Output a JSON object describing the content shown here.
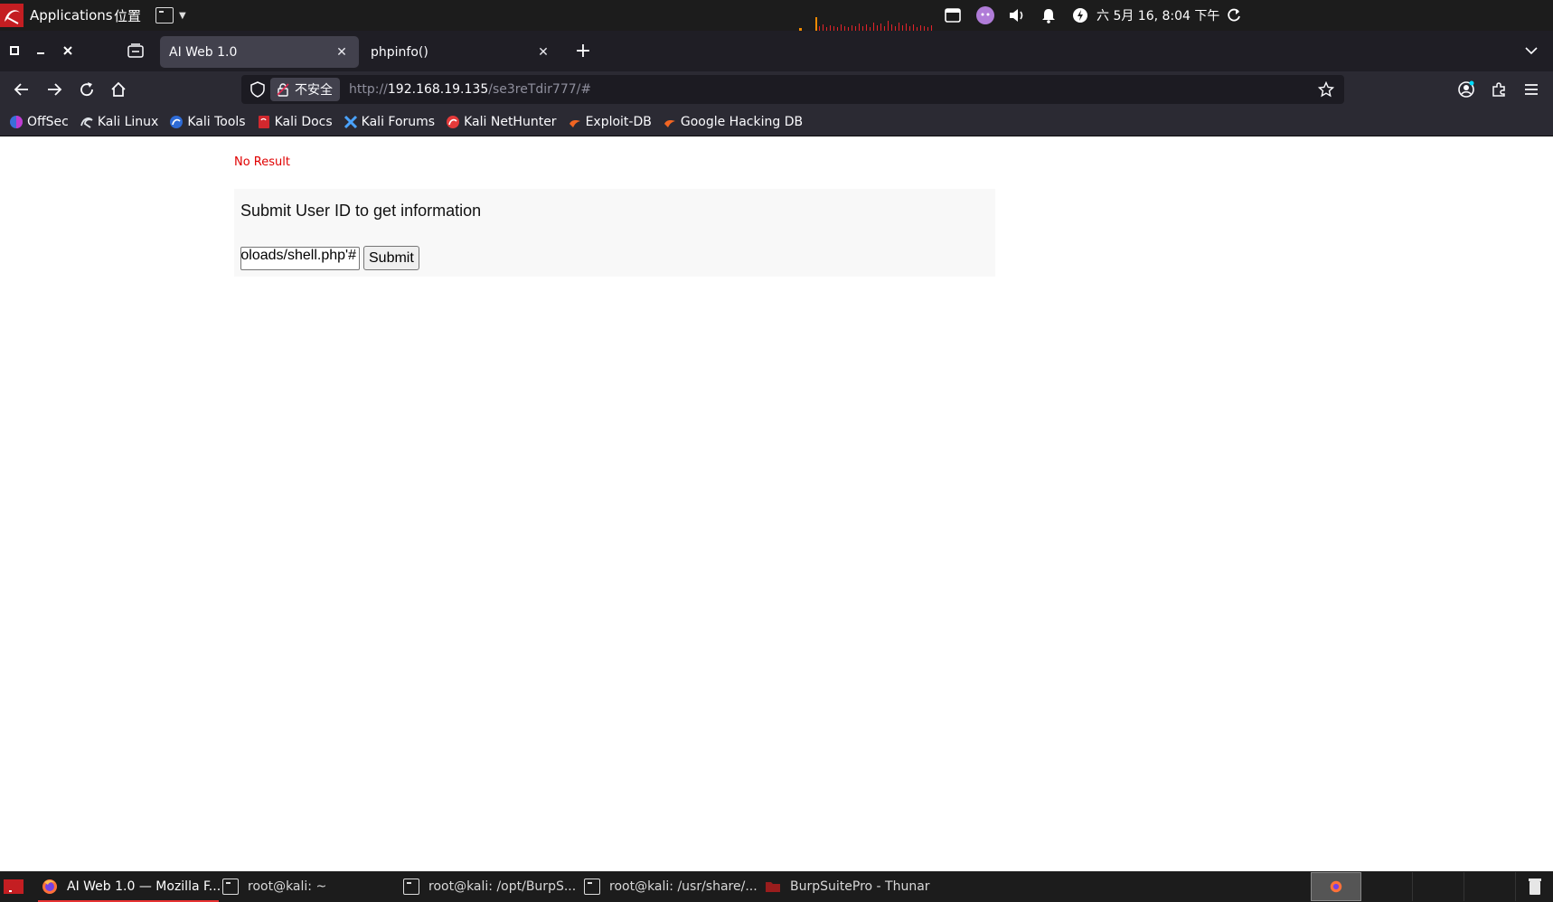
{
  "top_panel": {
    "applications_label": "Applications",
    "places_label": "位置",
    "clock": "六 5月 16,  8:04 下午"
  },
  "browser": {
    "tabs": [
      {
        "title": "AI Web 1.0",
        "active": true
      },
      {
        "title": "phpinfo()",
        "active": false
      }
    ],
    "address": {
      "security_label": "不安全",
      "scheme": "http://",
      "host": "192.168.19.135",
      "path": "/se3reTdir777/#"
    },
    "bookmarks": [
      {
        "label": "OffSec",
        "icon": "offsec-icon"
      },
      {
        "label": "Kali Linux",
        "icon": "kali-linux-icon"
      },
      {
        "label": "Kali Tools",
        "icon": "kali-tools-icon"
      },
      {
        "label": "Kali Docs",
        "icon": "kali-docs-icon"
      },
      {
        "label": "Kali Forums",
        "icon": "kali-forums-icon"
      },
      {
        "label": "Kali NetHunter",
        "icon": "kali-nethunter-icon"
      },
      {
        "label": "Exploit-DB",
        "icon": "exploit-db-icon"
      },
      {
        "label": "Google Hacking DB",
        "icon": "ghdb-icon"
      }
    ]
  },
  "page": {
    "status": "No Result",
    "heading": "Submit User ID to get information",
    "input_value": "oloads/shell.php'#",
    "submit_label": "Submit"
  },
  "taskbar": {
    "tasks": [
      {
        "label": "AI Web 1.0 — Mozilla F...",
        "icon": "firefox-icon",
        "active": true
      },
      {
        "label": "root@kali: ~",
        "icon": "terminal-icon",
        "active": false
      },
      {
        "label": "root@kali: /opt/BurpS...",
        "icon": "terminal-icon",
        "active": false
      },
      {
        "label": "root@kali: /usr/share/...",
        "icon": "terminal-icon",
        "active": false
      },
      {
        "label": "BurpSuitePro - Thunar",
        "icon": "folder-icon",
        "active": false
      }
    ]
  },
  "colors": {
    "no_result": "#e00000",
    "panel_bg": "#f8f8f8",
    "tab_active": "#42414d",
    "active_task_underline": "#e83333"
  }
}
